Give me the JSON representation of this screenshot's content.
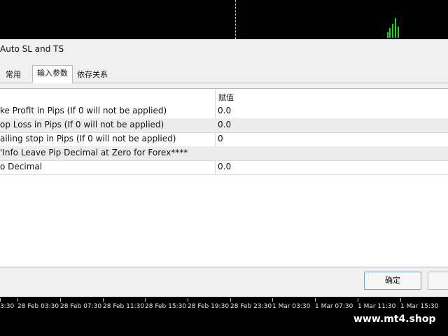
{
  "dialog": {
    "title": "Auto SL and TS",
    "tabs": [
      {
        "label": "常用"
      },
      {
        "label": "输入参数",
        "active": true
      },
      {
        "label": "依存关系"
      }
    ],
    "table": {
      "value_header": "赋值",
      "rows": [
        {
          "name": "ke Profit in Pips (If 0 will not be applied)",
          "value": "0.0"
        },
        {
          "name": "op Loss in Pips (If 0 will not be applied)",
          "value": "0.0"
        },
        {
          "name": "ailing stop in Pips (If 0 will not be applied)",
          "value": "0"
        },
        {
          "name": "'Info Leave Pip Decimal at Zero for Forex****",
          "value": ""
        },
        {
          "name": "o Decimal",
          "value": "0.0"
        }
      ]
    },
    "ok_label": "确定"
  },
  "time_axis": {
    "ticks": [
      "3:30",
      "28 Feb 03:30",
      "28 Feb 07:30",
      "28 Feb 11:30",
      "28 Feb 15:30",
      "28 Feb 19:30",
      "28 Feb 23:30",
      "1 Mar 03:30",
      "1 Mar 07:30",
      "1 Mar 11:30",
      "1 Mar 15:30"
    ]
  },
  "watermark": "www.mt4.shop"
}
